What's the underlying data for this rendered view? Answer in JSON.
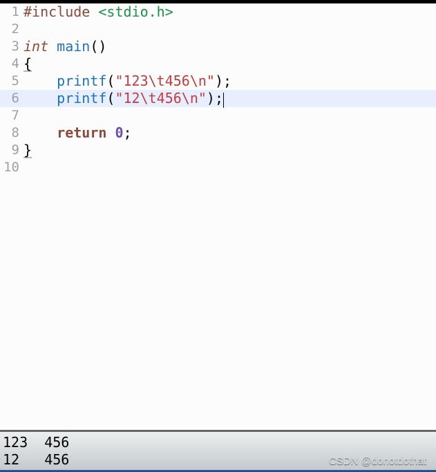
{
  "editor": {
    "highlighted_line": 6,
    "lines": [
      {
        "n": 1,
        "tokens": [
          {
            "t": "#include ",
            "c": "kw-pre"
          },
          {
            "t": "<stdio.h>",
            "c": "inc"
          }
        ]
      },
      {
        "n": 2,
        "tokens": []
      },
      {
        "n": 3,
        "tokens": [
          {
            "t": "int",
            "c": "kw-type"
          },
          {
            "t": " ",
            "c": ""
          },
          {
            "t": "main",
            "c": "fn"
          },
          {
            "t": "()",
            "c": "paren"
          }
        ]
      },
      {
        "n": 4,
        "tokens": [
          {
            "t": "{",
            "c": "brace underline"
          }
        ]
      },
      {
        "n": 5,
        "tokens": [
          {
            "t": "    ",
            "c": ""
          },
          {
            "t": "printf",
            "c": "fn"
          },
          {
            "t": "(",
            "c": "paren"
          },
          {
            "t": "\"123\\t456\\n\"",
            "c": "str"
          },
          {
            "t": ");",
            "c": "paren"
          }
        ]
      },
      {
        "n": 6,
        "tokens": [
          {
            "t": "    ",
            "c": ""
          },
          {
            "t": "printf",
            "c": "fn"
          },
          {
            "t": "(",
            "c": "paren"
          },
          {
            "t": "\"12\\t456\\n\"",
            "c": "str"
          },
          {
            "t": ");",
            "c": "paren"
          },
          {
            "t": "",
            "c": "cursor-here"
          }
        ]
      },
      {
        "n": 7,
        "tokens": []
      },
      {
        "n": 8,
        "tokens": [
          {
            "t": "    ",
            "c": ""
          },
          {
            "t": "return",
            "c": "ret"
          },
          {
            "t": " ",
            "c": ""
          },
          {
            "t": "0",
            "c": "num"
          },
          {
            "t": ";",
            "c": "paren"
          }
        ]
      },
      {
        "n": 9,
        "tokens": [
          {
            "t": "}",
            "c": "brace underline"
          }
        ]
      },
      {
        "n": 10,
        "tokens": []
      }
    ]
  },
  "output": {
    "lines": [
      "123  456",
      "12   456"
    ]
  },
  "watermark": "CSDN @donotdothat"
}
